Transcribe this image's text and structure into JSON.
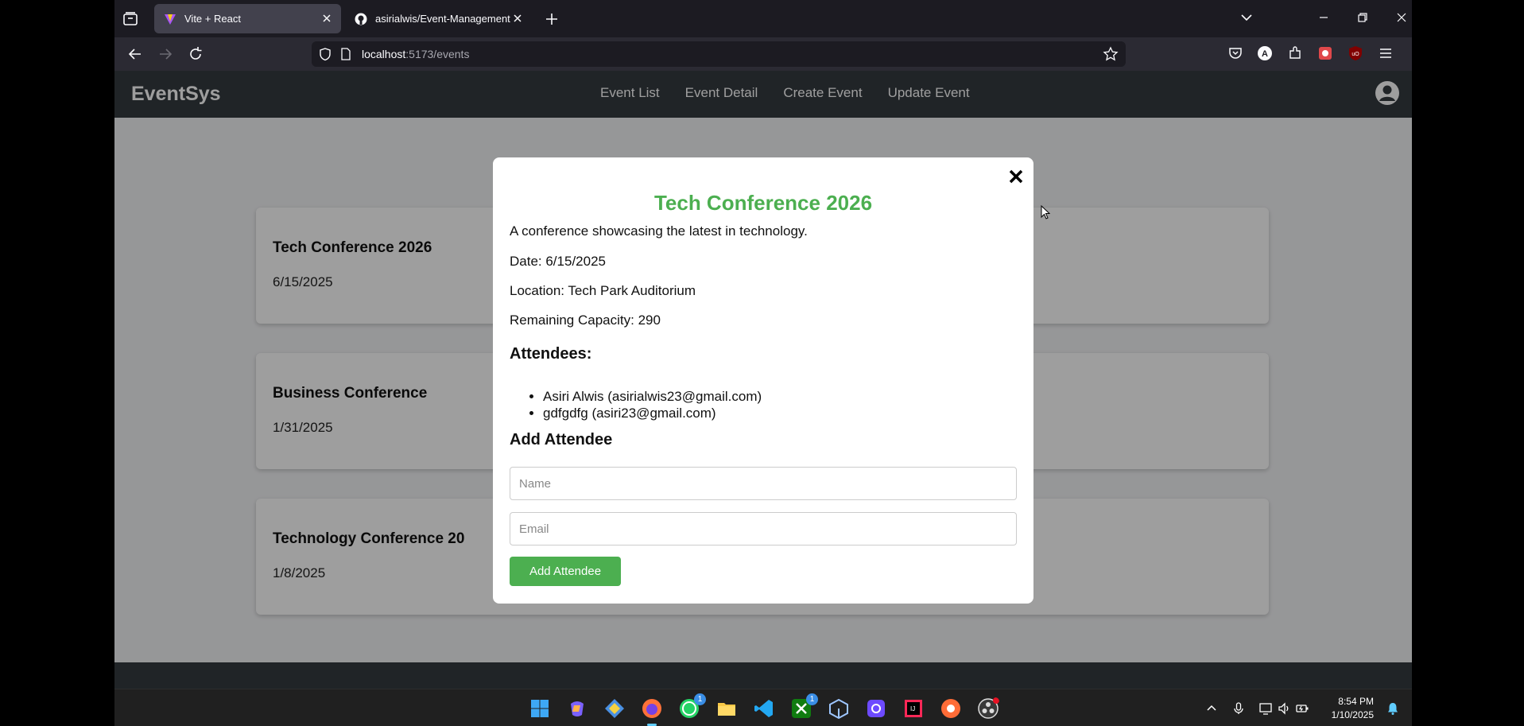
{
  "browser": {
    "tabs": [
      {
        "title": "Vite + React",
        "active": true
      },
      {
        "title": "asirialwis/Event-Management-S",
        "active": false
      }
    ],
    "url": {
      "host": "localhost",
      "path": ":5173/events"
    }
  },
  "app": {
    "brand": "EventSys",
    "nav": [
      {
        "label": "Event List"
      },
      {
        "label": "Event Detail"
      },
      {
        "label": "Create Event"
      },
      {
        "label": "Update Event"
      }
    ]
  },
  "events": [
    {
      "title": "Tech Conference 2026",
      "date": "6/15/2025"
    },
    {
      "title": "Business Conference",
      "date": "1/31/2025"
    },
    {
      "title": "Technology Conference 20",
      "date": "1/8/2025"
    }
  ],
  "modal": {
    "title": "Tech Conference 2026",
    "description": "A conference showcasing the latest in technology.",
    "date": "Date: 6/15/2025",
    "location": "Location: Tech Park Auditorium",
    "capacity": "Remaining Capacity: 290",
    "attendees_heading": "Attendees:",
    "attendees": [
      "Asiri Alwis (asirialwis23@gmail.com)",
      "gdfgdfg (asiri23@gmail.com)"
    ],
    "add_heading": "Add Attendee",
    "name_placeholder": "Name",
    "email_placeholder": "Email",
    "add_button": "Add Attendee"
  },
  "taskbar": {
    "badges": {
      "whatsapp": "1",
      "xbox": "1"
    },
    "time": "8:54 PM",
    "date": "1/10/2025"
  },
  "colors": {
    "accent_green": "#4caf50",
    "navbar": "#353a40",
    "browser_dark": "#1c1b22"
  }
}
